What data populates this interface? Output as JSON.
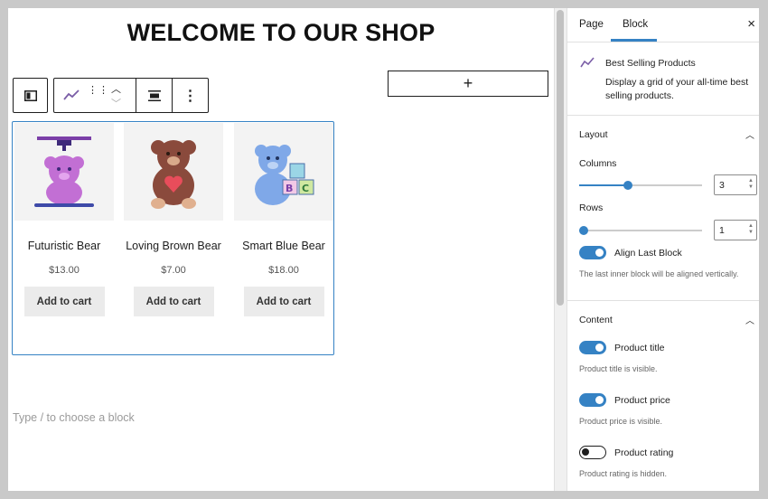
{
  "canvas": {
    "heading": "WELCOME TO OUR SHOP",
    "appender_symbol": "+",
    "placeholder": "Type / to choose a block"
  },
  "toolbar": {
    "icons": [
      "block-type-icon",
      "trend-icon",
      "drag-handle-icon",
      "move-up-icon",
      "move-down-icon",
      "align-icon",
      "more-options-icon"
    ]
  },
  "products": [
    {
      "title": "Futuristic Bear",
      "price": "$13.00",
      "button": "Add to cart",
      "color": "#c26fd4"
    },
    {
      "title": "Loving Brown Bear",
      "price": "$7.00",
      "button": "Add to cart",
      "color": "#8a4a3c"
    },
    {
      "title": "Smart Blue Bear",
      "price": "$18.00",
      "button": "Add to cart",
      "color": "#7fa8e8"
    }
  ],
  "sidebar": {
    "tabs": {
      "page": "Page",
      "block": "Block"
    },
    "close_symbol": "×",
    "block_card": {
      "title": "Best Selling Products",
      "description": "Display a grid of your all-time best selling products."
    },
    "layout": {
      "title": "Layout",
      "columns_label": "Columns",
      "columns_value": "3",
      "columns_fraction": 0.4,
      "rows_label": "Rows",
      "rows_value": "1",
      "rows_fraction": 0.0,
      "align_label": "Align Last Block",
      "align_help": "The last inner block will be aligned vertically."
    },
    "content": {
      "title": "Content",
      "product_title_label": "Product title",
      "product_title_help": "Product title is visible.",
      "product_price_label": "Product price",
      "product_price_help": "Product price is visible.",
      "product_rating_label": "Product rating",
      "product_rating_help": "Product rating is hidden."
    }
  },
  "colors": {
    "accent": "#3582c4",
    "trend_icon": "#7b5ea7"
  }
}
